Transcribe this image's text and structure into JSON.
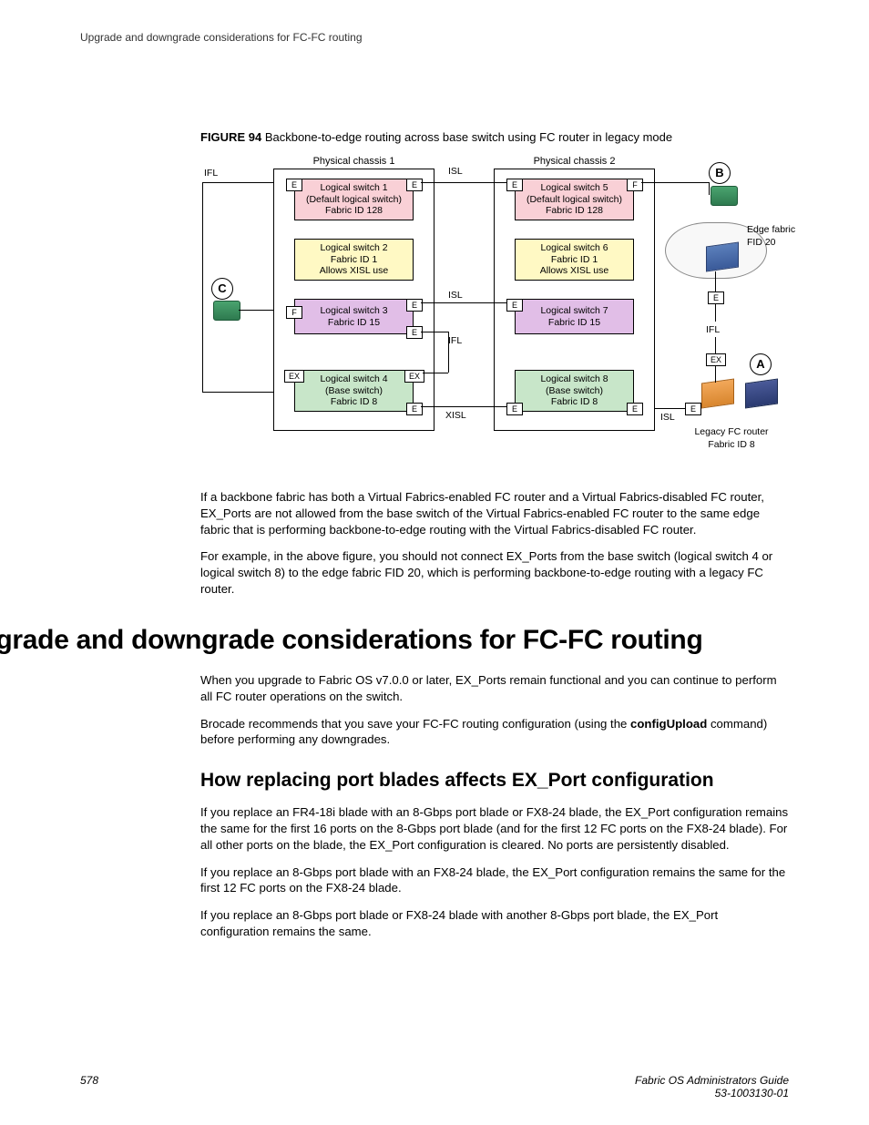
{
  "header": {
    "running": "Upgrade and downgrade considerations for FC-FC routing"
  },
  "figure": {
    "num": "FIGURE 94",
    "caption": "Backbone-to-edge routing across base switch using FC router in legacy mode",
    "chassis1": {
      "label": "Physical chassis 1",
      "sw1": {
        "line1": "Logical switch 1",
        "line2": "(Default logical switch)",
        "line3": "Fabric ID 128"
      },
      "sw2": {
        "line1": "Logical switch 2",
        "line2": "Fabric ID 1",
        "line3": "Allows XISL use"
      },
      "sw3": {
        "line1": "Logical switch 3",
        "line2": "Fabric ID 15"
      },
      "sw4": {
        "line1": "Logical switch 4",
        "line2": "(Base switch)",
        "line3": "Fabric ID 8"
      }
    },
    "chassis2": {
      "label": "Physical chassis 2",
      "sw5": {
        "line1": "Logical switch 5",
        "line2": "(Default logical switch)",
        "line3": "Fabric ID 128"
      },
      "sw6": {
        "line1": "Logical switch 6",
        "line2": "Fabric ID 1",
        "line3": "Allows XISL use"
      },
      "sw7": {
        "line1": "Logical switch 7",
        "line2": "Fabric ID 15"
      },
      "sw8": {
        "line1": "Logical switch 8",
        "line2": "(Base switch)",
        "line3": "Fabric ID 8"
      }
    },
    "links": {
      "ifl": "IFL",
      "isl": "ISL",
      "xisl": "XISL"
    },
    "ports": {
      "e": "E",
      "f": "F",
      "ex": "EX"
    },
    "markers": {
      "a": "A",
      "b": "B",
      "c": "C"
    },
    "ext": {
      "edge1": "Edge fabric",
      "edge2": "FID 20",
      "legacy1": "Legacy FC router",
      "legacy2": "Fabric ID 8"
    }
  },
  "body": {
    "p1": "If a backbone fabric has both a Virtual Fabrics-enabled FC router and a Virtual Fabrics-disabled FC router, EX_Ports are not allowed from the base switch of the Virtual Fabrics-enabled FC router to the same edge fabric that is performing backbone-to-edge routing with the Virtual Fabrics-disabled FC router.",
    "p2": "For example, in the above figure, you should not connect EX_Ports from the base switch (logical switch 4 or logical switch 8) to the edge fabric FID 20, which is performing backbone-to-edge routing with a legacy FC router."
  },
  "section": {
    "h1": "Upgrade and downgrade considerations for FC-FC routing",
    "p1": "When you upgrade to Fabric OS v7.0.0 or later, EX_Ports remain functional and you can continue to perform all FC router operations on the switch.",
    "p2a": "Brocade recommends that you save your FC-FC routing configuration (using the ",
    "p2b": "configUpload",
    "p2c": " command) before performing any downgrades.",
    "h2": "How replacing port blades affects EX_Port configuration",
    "p3": "If you replace an FR4-18i blade with an 8-Gbps port blade or FX8-24 blade, the EX_Port configuration remains the same for the first 16 ports on the 8-Gbps port blade (and for the first 12 FC ports on the FX8-24 blade). For all other ports on the blade, the EX_Port configuration is cleared. No ports are persistently disabled.",
    "p4": "If you replace an 8-Gbps port blade with an FX8-24 blade, the EX_Port configuration remains the same for the first 12 FC ports on the FX8-24 blade.",
    "p5": "If you replace an 8-Gbps port blade or FX8-24 blade with another 8-Gbps port blade, the EX_Port configuration remains the same."
  },
  "footer": {
    "page": "578",
    "doc1": "Fabric OS Administrators Guide",
    "doc2": "53-1003130-01"
  }
}
